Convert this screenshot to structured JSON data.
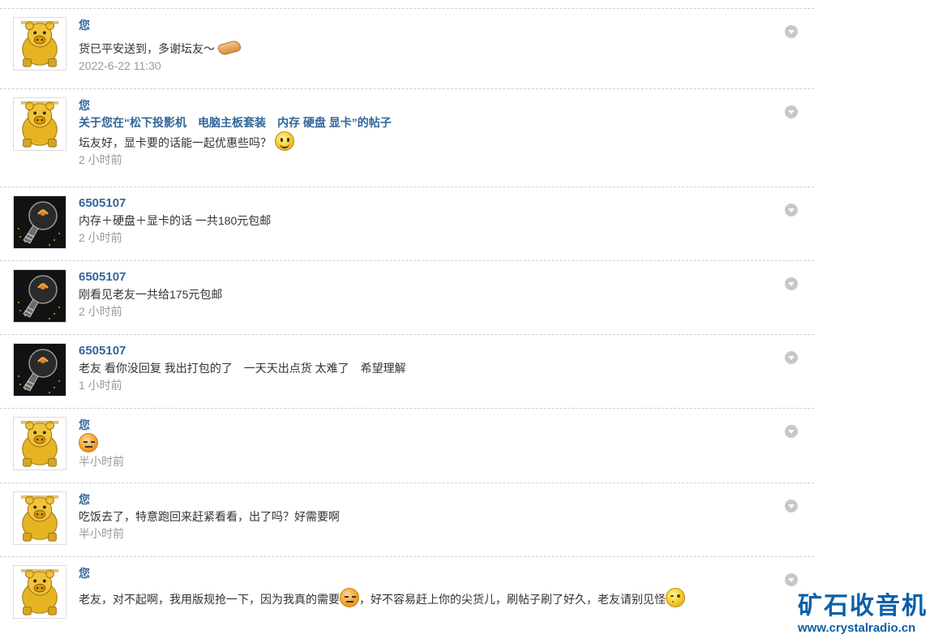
{
  "messages": [
    {
      "author": "您",
      "avatar": "gold-pig-avatar",
      "text": "货已平安送到，多谢坛友～",
      "emoticon": "handshake-icon",
      "time": "2022-6-22 11:30"
    },
    {
      "author": "您",
      "avatar": "gold-pig-avatar",
      "thread_link": "关于您在“松下投影机　电脑主板套装　内存 硬盘 显卡”的帖子",
      "text": "坛友好，显卡要的话能一起优惠些吗？",
      "emoticon": "smile-icon",
      "time": "2 小时前"
    },
    {
      "author": "6505107",
      "avatar": "light-bulb-avatar",
      "text": "内存＋硬盘＋显卡的话 一共180元包邮",
      "time": "2 小时前"
    },
    {
      "author": "6505107",
      "avatar": "light-bulb-avatar",
      "text": "刚看见老友一共给175元包邮",
      "time": "2 小时前"
    },
    {
      "author": "6505107",
      "avatar": "light-bulb-avatar",
      "text": "老友 看你没回复 我出打包的了　一天天出点货 太难了　希望理解",
      "time": "1 小时前"
    },
    {
      "author": "您",
      "avatar": "gold-pig-avatar",
      "text": "",
      "emoticon": "sweat-icon",
      "time": "半小时前"
    },
    {
      "author": "您",
      "avatar": "gold-pig-avatar",
      "text": "吃饭去了，特意跑回来赶紧看看，出了吗？好需要啊",
      "time": "半小时前"
    },
    {
      "author": "您",
      "avatar": "gold-pig-avatar",
      "text_before": "老友，对不起啊，我用版规抢一下，因为我真的需要",
      "text_after": "，好不容易赶上你的尖货儿，刷帖子刷了好久，老友请别见怪",
      "emoticons": [
        "sweat-icon",
        "wink-icon"
      ]
    }
  ],
  "watermark": {
    "brand": "矿石收音机",
    "url": "www.crystalradio.cn"
  },
  "colors": {
    "author": "#336699",
    "time": "#999999",
    "divider": "#cfcfcf",
    "watermark": "#0b5fa8"
  }
}
